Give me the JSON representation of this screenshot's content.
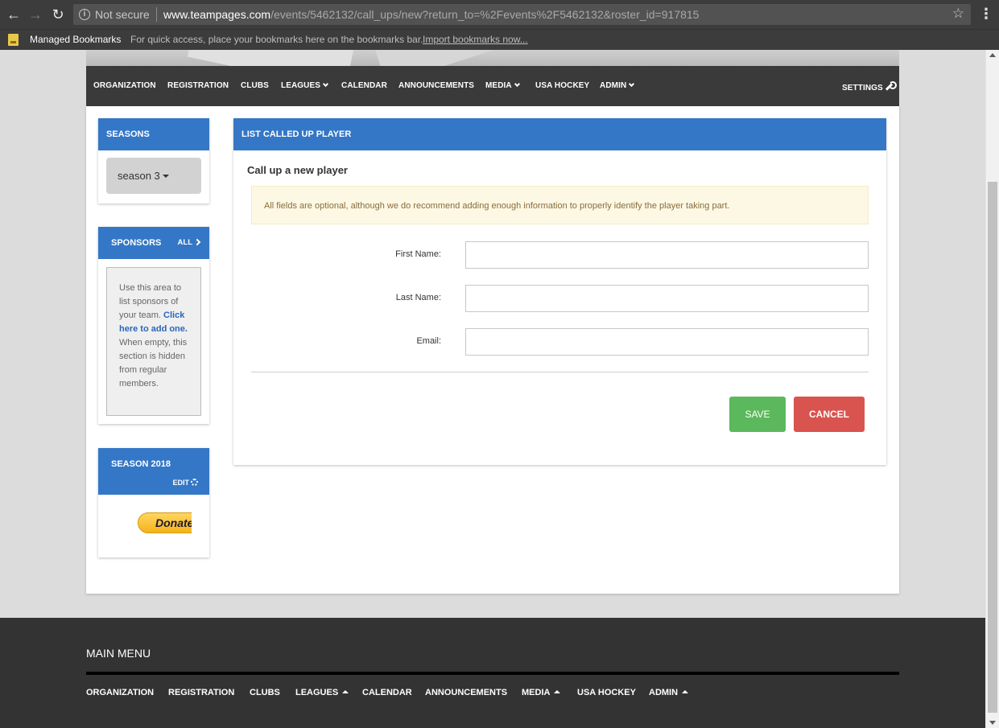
{
  "browser": {
    "security_label": "Not secure",
    "url_host": "www.teampages.com",
    "url_path": "/events/5462132/call_ups/new?return_to=%2Fevents%2F5462132&roster_id=917815"
  },
  "bookmarks": {
    "managed": "Managed Bookmarks",
    "hint": "For quick access, place your bookmarks here on the bookmarks bar.",
    "import": "Import bookmarks now..."
  },
  "nav": {
    "organization": "ORGANIZATION",
    "registration": "REGISTRATION",
    "clubs": "CLUBS",
    "leagues": "LEAGUES",
    "calendar": "CALENDAR",
    "announcements": "ANNOUNCEMENTS",
    "media": "MEDIA",
    "usa_hockey": "USA HOCKEY",
    "admin": "ADMIN",
    "settings": "SETTINGS"
  },
  "sidebar": {
    "seasons_title": "SEASONS",
    "season_selected": "season 3",
    "sponsors_title": "SPONSORS",
    "sponsors_all": "ALL",
    "sponsors_text_1": "Use this area to list sponsors of your team.",
    "sponsors_link": "Click here to add one.",
    "sponsors_text_2": "When empty, this section is hidden from regular members.",
    "season2018_title": "SEASON 2018",
    "season2018_edit": "EDIT",
    "donate_label": "Donate"
  },
  "main": {
    "panel_title": "LIST CALLED UP PLAYER",
    "subtitle": "Call up a new player",
    "alert": "All fields are optional, although we do recommend adding enough information to properly identify the player taking part.",
    "first_name_label": "First Name:",
    "first_name_value": "",
    "last_name_label": "Last Name:",
    "last_name_value": "",
    "email_label": "Email:",
    "email_value": "",
    "save_label": "SAVE",
    "cancel_label": "CANCEL"
  },
  "footer": {
    "title": "MAIN MENU",
    "organization": "ORGANIZATION",
    "registration": "REGISTRATION",
    "clubs": "CLUBS",
    "leagues": "LEAGUES",
    "calendar": "CALENDAR",
    "announcements": "ANNOUNCEMENTS",
    "media": "MEDIA",
    "usa_hockey": "USA HOCKEY",
    "admin": "ADMIN"
  },
  "colors": {
    "accent_blue": "#3477c6",
    "save_green": "#5cb85c",
    "cancel_red": "#d9534f",
    "nav_dark": "#3a3a3a",
    "footer_dark": "#333333"
  }
}
